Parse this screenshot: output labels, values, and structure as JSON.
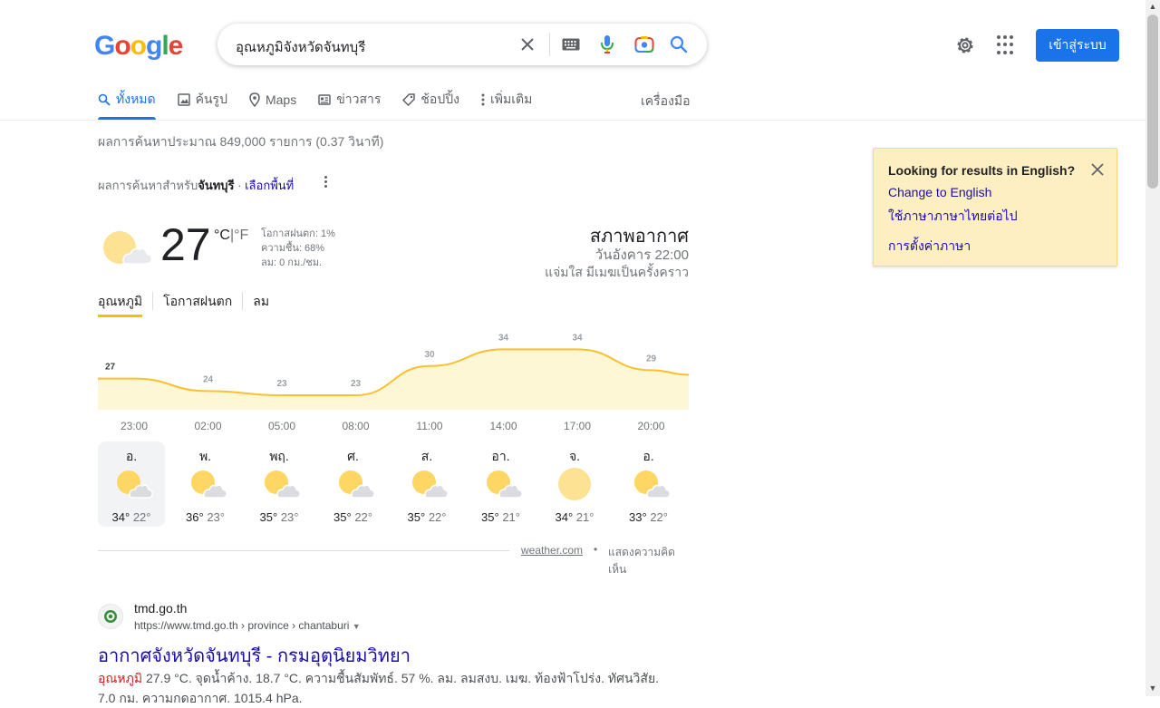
{
  "header": {
    "logo": [
      "G",
      "o",
      "o",
      "g",
      "l",
      "e"
    ],
    "logo_colors": [
      "#4285f4",
      "#ea4335",
      "#fbbc05",
      "#4285f4",
      "#34a853",
      "#ea4335"
    ],
    "search_query": "อุณหภูมิจังหวัดจันทบุรี",
    "signin_label": "เข้าสู่ระบบ"
  },
  "tabs": [
    {
      "label": "ทั้งหมด",
      "icon": "search-icon",
      "active": true
    },
    {
      "label": "ค้นรูป",
      "icon": "image-icon",
      "active": false
    },
    {
      "label": "Maps",
      "icon": "map-pin-icon",
      "active": false
    },
    {
      "label": "ข่าวสาร",
      "icon": "news-icon",
      "active": false
    },
    {
      "label": "ช้อปปิ้ง",
      "icon": "tag-icon",
      "active": false
    },
    {
      "label": "เพิ่มเติม",
      "icon": "more-vert-icon",
      "active": false
    }
  ],
  "tools_label": "เครื่องมือ",
  "result_stats": "ผลการค้นหาประมาณ 849,000 รายการ (0.37 วินาที)",
  "location": {
    "prefix": "ผลการค้นหาสำหรับ",
    "place": "จันทบุรี",
    "separator": " · ",
    "choose_area": "เลือกพื้นที่"
  },
  "weather": {
    "temp": "27",
    "unit_c": "°C",
    "unit_sep": "|",
    "unit_f": "°F",
    "precip": "โอกาสฝนตก: 1%",
    "humidity": "ความชื้น: 68%",
    "wind": "ลม: 0 กม./ชม.",
    "title": "สภาพอากาศ",
    "datetime": "วันอังคาร 22:00",
    "condition": "แจ่มใส มีเมฆเป็นครั้งคราว",
    "tabs": [
      "อุณหภูมิ",
      "โอกาสฝนตก",
      "ลม"
    ],
    "hourly_times": [
      "23:00",
      "02:00",
      "05:00",
      "08:00",
      "11:00",
      "14:00",
      "17:00",
      "20:00"
    ],
    "days": [
      {
        "name": "อ.",
        "hi": "34°",
        "lo": "22°",
        "icon": "partly-cloudy-icon",
        "active": true
      },
      {
        "name": "พ.",
        "hi": "36°",
        "lo": "23°",
        "icon": "partly-cloudy-icon",
        "active": false
      },
      {
        "name": "พฤ.",
        "hi": "35°",
        "lo": "23°",
        "icon": "partly-cloudy-icon",
        "active": false
      },
      {
        "name": "ศ.",
        "hi": "35°",
        "lo": "22°",
        "icon": "partly-cloudy-icon",
        "active": false
      },
      {
        "name": "ส.",
        "hi": "35°",
        "lo": "22°",
        "icon": "partly-cloudy-icon",
        "active": false
      },
      {
        "name": "อา.",
        "hi": "35°",
        "lo": "21°",
        "icon": "partly-cloudy-icon",
        "active": false
      },
      {
        "name": "จ.",
        "hi": "34°",
        "lo": "21°",
        "icon": "sunny-icon",
        "active": false
      },
      {
        "name": "อ.",
        "hi": "33°",
        "lo": "22°",
        "icon": "partly-cloudy-icon",
        "active": false
      }
    ],
    "source": "weather.com",
    "dot": "•",
    "feedback": "แสดงความคิดเห็น"
  },
  "chart_data": {
    "type": "area",
    "x": [
      "23:00",
      "02:00",
      "05:00",
      "08:00",
      "11:00",
      "14:00",
      "17:00",
      "20:00"
    ],
    "series": [
      {
        "values": [
          27,
          24,
          23,
          23,
          30,
          34,
          34,
          29
        ]
      }
    ],
    "colors": {
      "line": "#fbc02d",
      "fill": "#fef7d6"
    }
  },
  "result": {
    "site": "tmd.go.th",
    "url": "https://www.tmd.go.th › province › chantaburi",
    "title": "อากาศจังหวัดจันทบุรี - กรมอุตุนิยมวิทยา",
    "snippet_em": "อุณหภูมิ",
    "snippet": " 27.9 °C. จุดน้ำค้าง. 18.7 °C. ความชื้นสัมพัทธ์. 57 %. ลม. ลมสงบ. เมฆ. ท้องฟ้าโปร่ง. ทัศนวิสัย.",
    "snippet2": "7.0 กม. ความกดอากาศ. 1015.4 hPa."
  },
  "lang_card": {
    "title": "Looking for results in English?",
    "change": "Change to English",
    "keep": "ใช้ภาษาภาษาไทยต่อไป",
    "settings": "การตั้งค่าภาษา"
  }
}
